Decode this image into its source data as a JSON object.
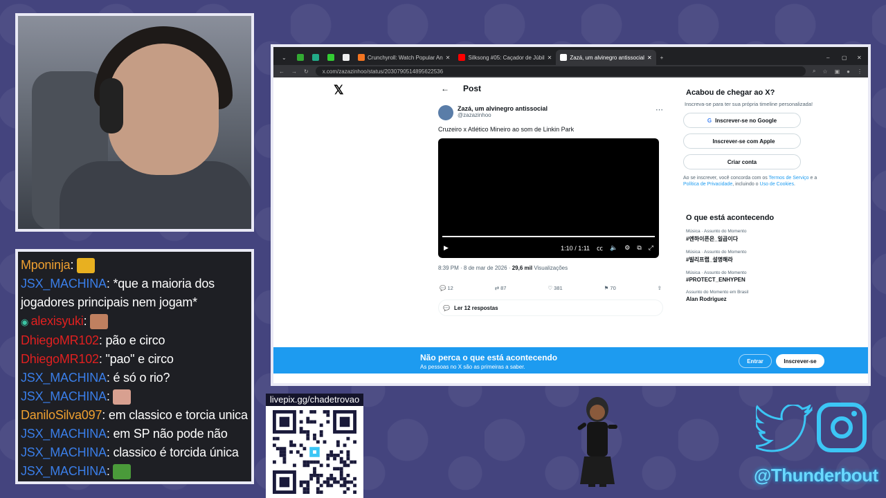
{
  "chat": {
    "messages": [
      {
        "user": "Mponinja",
        "color": "#f0a030",
        "text": "",
        "emote": "emote-gold"
      },
      {
        "user": "JSX_MACHINA",
        "color": "#3a7ee8",
        "text": "*que a maioria dos"
      },
      {
        "user": "",
        "color": "#3a7ee8",
        "text": "jogadores principais nem jogam*"
      },
      {
        "user": "alexisyuki",
        "color": "#e02020",
        "text": "",
        "emote": "emote-face",
        "prefix_emote": true
      },
      {
        "user": "DhiegoMR102",
        "color": "#e02020",
        "text": "pão e circo"
      },
      {
        "user": "DhiegoMR102",
        "color": "#e02020",
        "text": "\"pao\" e circo"
      },
      {
        "user": "JSX_MACHINA",
        "color": "#3a7ee8",
        "text": "é só o rio?"
      },
      {
        "user": "JSX_MACHINA",
        "color": "#3a7ee8",
        "text": "",
        "emote": "emote-face2"
      },
      {
        "user": "DaniloSilva097",
        "color": "#f0a030",
        "text": "em classico e torcia unica"
      },
      {
        "user": "JSX_MACHINA",
        "color": "#3a7ee8",
        "text": "em SP não pode não"
      },
      {
        "user": "JSX_MACHINA",
        "color": "#3a7ee8",
        "text": "classico é torcida única"
      },
      {
        "user": "JSX_MACHINA",
        "color": "#3a7ee8",
        "text": "",
        "emote": "emote-pepe"
      }
    ]
  },
  "livepix": {
    "label": "livepix.gg/chadetrovao"
  },
  "browser": {
    "tabs": [
      {
        "label": "",
        "color": "#3a3"
      },
      {
        "label": "",
        "color": "#2a8"
      },
      {
        "label": "",
        "color": "#3c3"
      },
      {
        "label": "",
        "color": "#eee"
      },
      {
        "label": "Crunchyroll: Watch Popular An",
        "color": "#f47521"
      },
      {
        "label": "Silksong #05: Caçador de Júbil",
        "color": "#f00"
      },
      {
        "label": "Zazá, um alvinegro antissocial",
        "color": "#fff"
      }
    ],
    "url": "x.com/zazazinhoo/status/2030790514895622536"
  },
  "post": {
    "header": "Post",
    "author_name": "Zazá, um alvinegro antissocial",
    "author_handle": "@zazazinhoo",
    "text": "Cruzeiro x Atlético Mineiro ao som de Linkin Park",
    "video_time": "1:10 / 1:11",
    "date": "8:39 PM · 8 de mar de 2026 · ",
    "views": "29,6 mil",
    "views_label": " Visualizações",
    "replies": "12",
    "reposts": "87",
    "likes": "381",
    "bookmarks": "70",
    "read_replies": "Ler 12 respostas"
  },
  "sidebar": {
    "title": "Acabou de chegar ao X?",
    "subtitle": "Inscreva-se para ter sua própria timeline personalizada!",
    "google": "Inscrever-se no Google",
    "apple": "Inscrever-se com Apple",
    "create": "Criar conta",
    "terms_a": "Ao se inscrever, você concorda com os ",
    "terms_b": "Termos de Serviço",
    "terms_c": " e a ",
    "terms_d": "Política de Privacidade",
    "terms_e": ", incluindo o ",
    "terms_f": "Uso de Cookies",
    "terms_g": ".",
    "trends_title": "O que está acontecendo",
    "trends": [
      {
        "cat": "Música · Assunto do Momento",
        "tag": "#엔하이픈은_일곱이다"
      },
      {
        "cat": "Música · Assunto do Momento",
        "tag": "#빌리프랩_설명해라"
      },
      {
        "cat": "Música · Assunto do Momento",
        "tag": "#PROTECT_ENHYPEN"
      },
      {
        "cat": "Assunto do Momento em Brasil",
        "tag": "Alan Rodriguez"
      }
    ]
  },
  "banner": {
    "title": "Não perca o que está acontecendo",
    "subtitle": "As pessoas no X são as primeiras a saber.",
    "enter": "Entrar",
    "signup": "Inscrever-se"
  },
  "social": {
    "handle": "@Thunderbout"
  }
}
